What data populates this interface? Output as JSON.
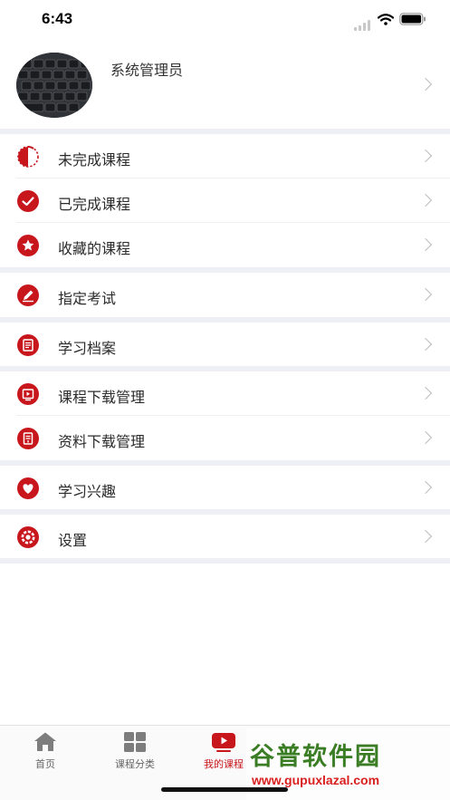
{
  "status_bar": {
    "time": "6:43"
  },
  "profile": {
    "name": "系统管理员"
  },
  "menu": [
    {
      "key": "unfinished",
      "label": "未完成课程",
      "icon": "half-circle-icon"
    },
    {
      "key": "finished",
      "label": "已完成课程",
      "icon": "check-circle-icon"
    },
    {
      "key": "favorites",
      "label": "收藏的课程",
      "icon": "star-circle-icon"
    },
    {
      "key": "exams",
      "label": "指定考试",
      "icon": "pencil-circle-icon"
    },
    {
      "key": "archive",
      "label": "学习档案",
      "icon": "document-icon"
    },
    {
      "key": "course_download",
      "label": "课程下载管理",
      "icon": "video-download-icon"
    },
    {
      "key": "material_download",
      "label": "资料下载管理",
      "icon": "file-download-icon"
    },
    {
      "key": "interest",
      "label": "学习兴趣",
      "icon": "heart-icon"
    },
    {
      "key": "settings",
      "label": "设置",
      "icon": "gear-icon"
    }
  ],
  "tabbar": {
    "home": "首页",
    "category": "课程分类",
    "mine": "我的课程"
  },
  "watermark": {
    "title": "谷普软件园",
    "url": "www.gupuxlazal.com"
  },
  "colors": {
    "accent": "#c8161d",
    "separator": "#eff0f5",
    "chevron": "#bbbbbb"
  }
}
